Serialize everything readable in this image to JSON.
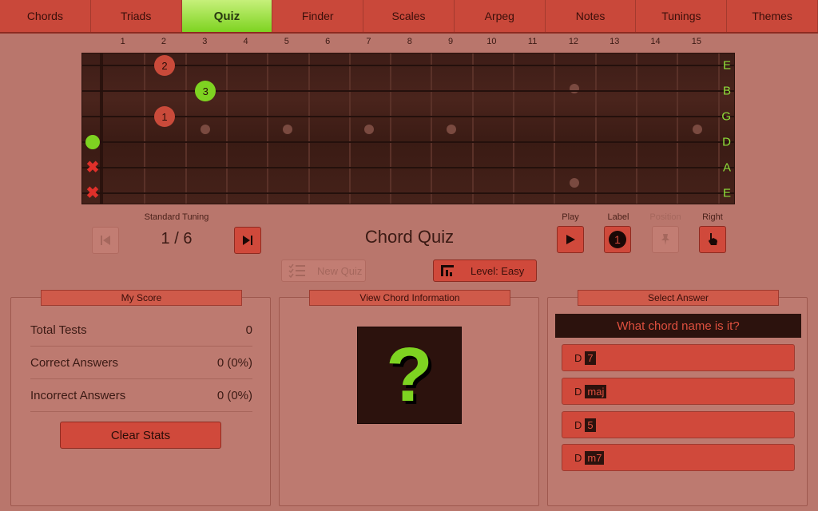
{
  "nav": {
    "tabs": [
      {
        "label": "Chords"
      },
      {
        "label": "Triads"
      },
      {
        "label": "Quiz",
        "active": true
      },
      {
        "label": "Finder"
      },
      {
        "label": "Scales"
      },
      {
        "label": "Arpeg"
      },
      {
        "label": "Notes"
      },
      {
        "label": "Tunings"
      },
      {
        "label": "Themes"
      }
    ]
  },
  "fretboard": {
    "fret_numbers": [
      "1",
      "2",
      "3",
      "4",
      "5",
      "6",
      "7",
      "8",
      "9",
      "10",
      "11",
      "12",
      "13",
      "14",
      "15"
    ],
    "string_names": [
      "E",
      "B",
      "G",
      "D",
      "A",
      "E"
    ],
    "notes": [
      {
        "string": 0,
        "fret": 2,
        "label": "2",
        "color": "red"
      },
      {
        "string": 1,
        "fret": 3,
        "label": "3",
        "color": "green"
      },
      {
        "string": 2,
        "fret": 2,
        "label": "1",
        "color": "red"
      }
    ],
    "open_strings": [
      3
    ],
    "muted_strings": [
      4,
      5
    ]
  },
  "controls": {
    "tuning_label": "Standard Tuning",
    "counter": "1 / 6",
    "title": "Chord Quiz",
    "play_label": "Play",
    "label_label": "Label",
    "position_label": "Position",
    "right_label": "Right",
    "new_quiz_label": "New Quiz",
    "level_label": "Level: Easy"
  },
  "score": {
    "header": "My Score",
    "rows": [
      {
        "label": "Total Tests",
        "value": "0"
      },
      {
        "label": "Correct Answers",
        "value": "0 (0%)"
      },
      {
        "label": "Incorrect Answers",
        "value": "0 (0%)"
      }
    ],
    "clear_label": "Clear Stats"
  },
  "info": {
    "header": "View Chord Information",
    "placeholder": "?"
  },
  "answer": {
    "header": "Select Answer",
    "question": "What chord name is it?",
    "options": [
      {
        "root": "D",
        "type": "7"
      },
      {
        "root": "D",
        "type": "maj"
      },
      {
        "root": "D",
        "type": "5"
      },
      {
        "root": "D",
        "type": "m7"
      }
    ]
  },
  "colors": {
    "accent_red": "#d0493b",
    "accent_green": "#7ed321",
    "background": "#b9766c",
    "dark": "#2c120d"
  }
}
